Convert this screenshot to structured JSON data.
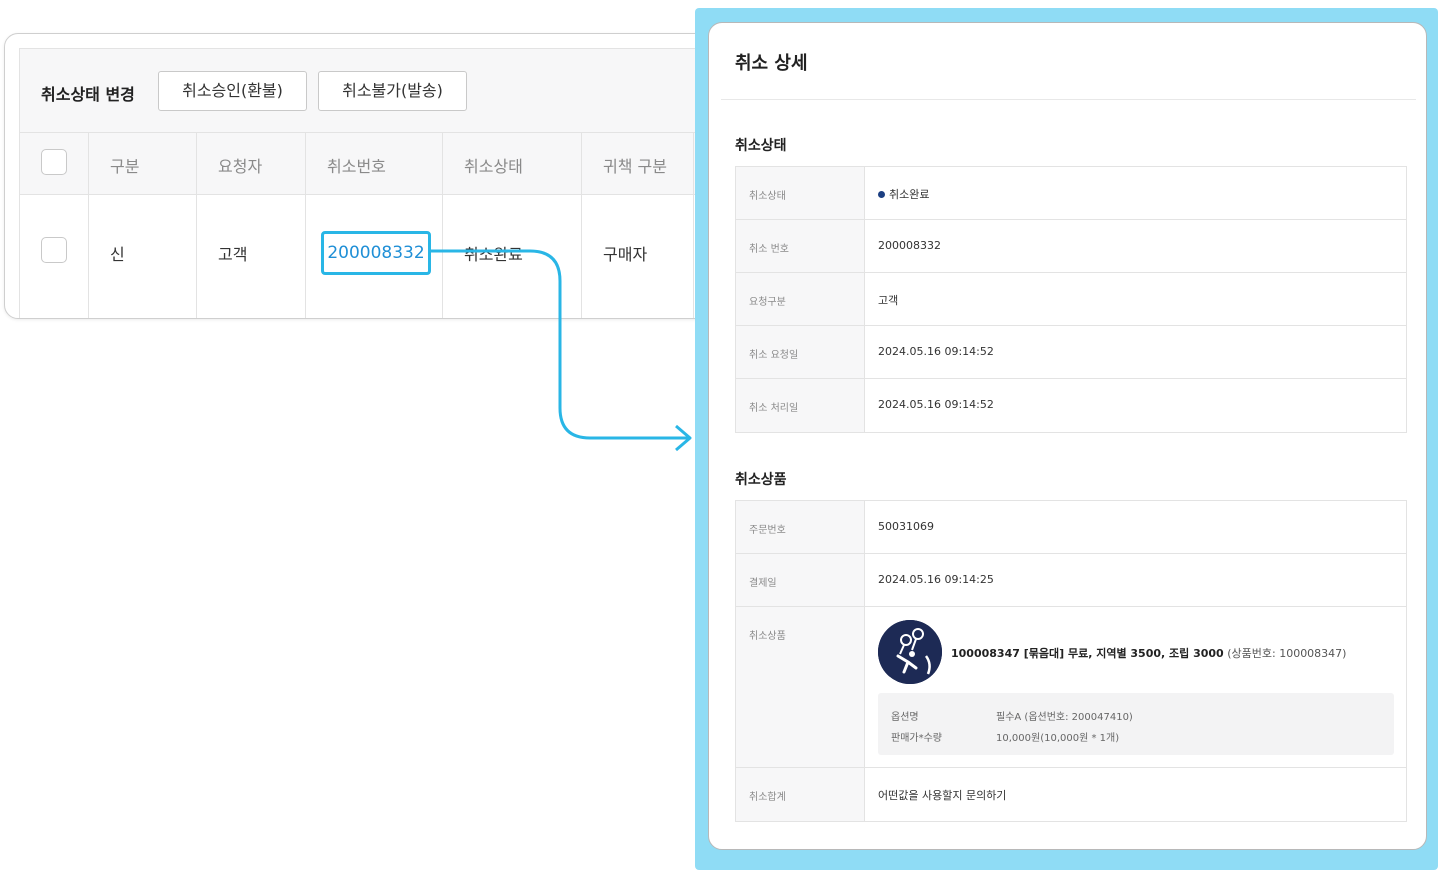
{
  "list": {
    "toolbar_label": "취소상태 변경",
    "approve_button": "취소승인(환불)",
    "deny_button": "취소불가(발송)",
    "headers": [
      "구분",
      "요청자",
      "취소번호",
      "취소상태",
      "귀책 구분"
    ],
    "row": {
      "type": "신",
      "requester": "고객",
      "cancel_no": "200008332",
      "status": "취소완료",
      "fault": "구매자"
    }
  },
  "modal": {
    "title": "취소 상세",
    "status_section": {
      "title": "취소상태",
      "rows": [
        {
          "label": "취소상태",
          "value": "취소완료"
        },
        {
          "label": "취소 번호",
          "value": "200008332"
        },
        {
          "label": "요청구분",
          "value": "고객"
        },
        {
          "label": "취소 요청일",
          "value": "2024.05.16 09:14:52"
        },
        {
          "label": "취소 처리일",
          "value": "2024.05.16 09:14:52"
        }
      ]
    },
    "product_section": {
      "title": "취소상품",
      "order_no_label": "주문번호",
      "order_no": "50031069",
      "paid_label": "결제일",
      "paid_at": "2024.05.16 09:14:25",
      "product_label": "취소상품",
      "product_name": "100008347 [묶음대] 무료, 지역별 3500, 조립 3000",
      "product_sub": "(상품번호: 100008347)",
      "option_name_label": "옵션명",
      "option_name": "필수A (옵션번호: 200047410)",
      "price_label": "판매가*수량",
      "price": "10,000원(10,000원 * 1개)",
      "total_label": "취소합계",
      "total": "어떤값을 사용할지 문의하기"
    }
  },
  "colors": {
    "accent": "#29b6e6",
    "link": "#1f8fd6",
    "status_dot": "#1c3f82",
    "frame": "#8fdcf5"
  }
}
